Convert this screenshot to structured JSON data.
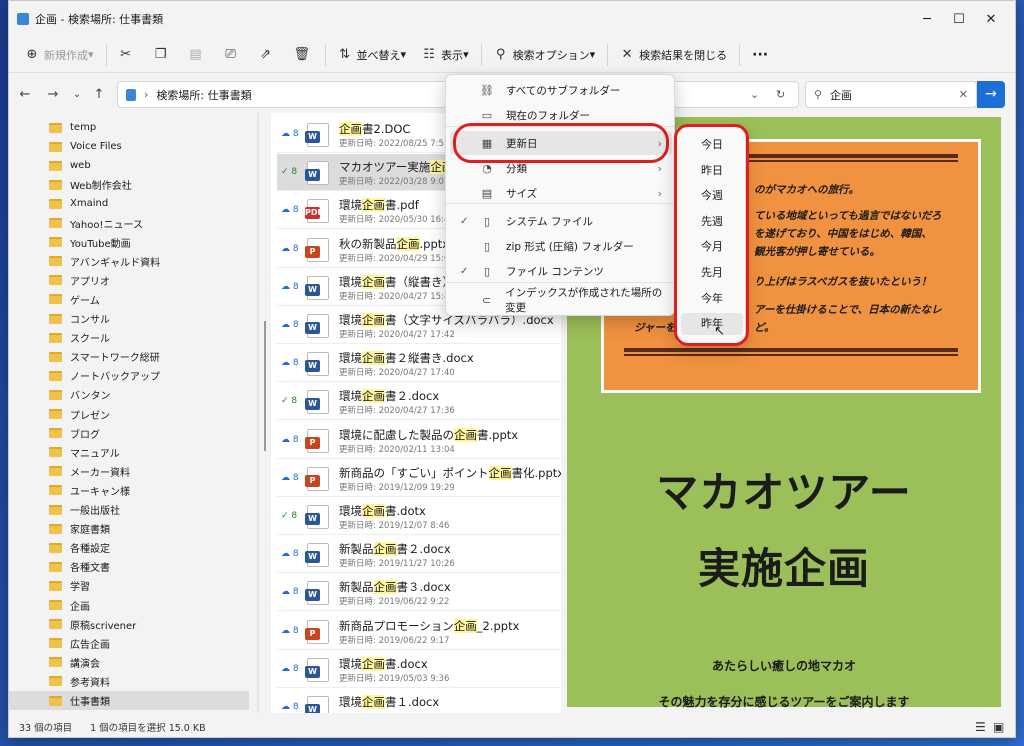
{
  "window": {
    "title": "企画 - 検索場所: 仕事書類"
  },
  "window_controls": {
    "minimize": "─",
    "maximize": "☐",
    "close": "✕"
  },
  "toolbar": {
    "new_label": "新規作成",
    "sort_label": "並べ替え",
    "view_label": "表示",
    "search_options_label": "検索オプション",
    "close_results_label": "検索結果を閉じる",
    "more_label": "···"
  },
  "address": {
    "path": "検索場所: 仕事書類",
    "chevron": "›"
  },
  "search": {
    "value": "企画",
    "clear": "✕",
    "go": "→"
  },
  "sidebar": {
    "items": [
      "temp",
      "Voice Files",
      "web",
      "Web制作会社",
      "Xmaind",
      "Yahoo!ニュース",
      "YouTube動画",
      "アバンギャルド資料",
      "アプリオ",
      "ゲーム",
      "コンサル",
      "スクール",
      "スマートワーク総研",
      "ノートバックアップ",
      "バンタン",
      "プレゼン",
      "ブログ",
      "マニュアル",
      "メーカー資料",
      "ユーキャン様",
      "一般出版社",
      "家庭書類",
      "各種設定",
      "各種文書",
      "学習",
      "企画",
      "原稿scrivener",
      "広告企画",
      "講演会",
      "参考資料",
      "仕事書類"
    ]
  },
  "files": [
    {
      "pre": "",
      "hl": "企画",
      "post": "書2.DOC",
      "date": "更新日時: 2022/08/25 7:53",
      "type": "W",
      "status": "☁ 8"
    },
    {
      "pre": "マカオツアー実施",
      "hl": "企画",
      "post": "3",
      "date": "更新日時: 2022/03/28 9:07",
      "type": "W",
      "status": "✓ 8"
    },
    {
      "pre": "環境",
      "hl": "企画",
      "post": "書.pdf",
      "date": "更新日時: 2020/05/30 16:4",
      "type": "PDF",
      "status": "☁ 8"
    },
    {
      "pre": "秋の新製品",
      "hl": "企画",
      "post": ".pptx",
      "date": "更新日時: 2020/04/29 15:0",
      "type": "P",
      "status": "☁ 8"
    },
    {
      "pre": "環境",
      "hl": "企画",
      "post": "書（縦書き）",
      "date": "更新日時: 2020/04/27 15:4",
      "type": "W",
      "status": "☁ 8"
    },
    {
      "pre": "環境",
      "hl": "企画",
      "post": "書（文字サイズバラバラ）.docx",
      "date": "更新日時: 2020/04/27 17:42",
      "type": "W",
      "status": "☁ 8"
    },
    {
      "pre": "環境",
      "hl": "企画",
      "post": "書２縦書き.docx",
      "date": "更新日時: 2020/04/27 17:40",
      "type": "W",
      "status": "☁ 8"
    },
    {
      "pre": "環境",
      "hl": "企画",
      "post": "書２.docx",
      "date": "更新日時: 2020/04/27 17:36",
      "type": "W",
      "status": "✓ 8"
    },
    {
      "pre": "環境に配慮した製品の",
      "hl": "企画",
      "post": "書.pptx",
      "date": "更新日時: 2020/02/11 13:04",
      "type": "P",
      "status": "☁ 8"
    },
    {
      "pre": "新商品の「すごい」ポイント",
      "hl": "企画",
      "post": "書化.pptx",
      "date": "更新日時: 2019/12/09 19:29",
      "type": "P",
      "status": "☁ 8"
    },
    {
      "pre": "環境",
      "hl": "企画",
      "post": "書.dotx",
      "date": "更新日時: 2019/12/07 8:46",
      "type": "W",
      "status": "✓ 8"
    },
    {
      "pre": "新製品",
      "hl": "企画",
      "post": "書２.docx",
      "date": "更新日時: 2019/11/27 10:26",
      "type": "W",
      "status": "☁ 8"
    },
    {
      "pre": "新製品",
      "hl": "企画",
      "post": "書３.docx",
      "date": "更新日時: 2019/06/22 9:22",
      "type": "W",
      "status": "☁ 8"
    },
    {
      "pre": "新商品プロモーション",
      "hl": "企画",
      "post": "_2.pptx",
      "date": "更新日時: 2019/06/22 9:17",
      "type": "P",
      "status": "☁ 8"
    },
    {
      "pre": "環境",
      "hl": "企画",
      "post": "書.docx",
      "date": "更新日時: 2019/05/03 9:36",
      "type": "W",
      "status": "☁ 8"
    },
    {
      "pre": "環境",
      "hl": "企画",
      "post": "書１.docx",
      "date": "",
      "type": "W",
      "status": "☁ 8"
    }
  ],
  "menu": {
    "items": [
      {
        "label": "すべてのサブフォルダー",
        "icon": "⛓",
        "check": "",
        "arrow": ""
      },
      {
        "label": "現在のフォルダー",
        "icon": "▭",
        "check": "",
        "arrow": ""
      },
      {
        "label": "更新日",
        "icon": "▦",
        "check": "",
        "arrow": "›"
      },
      {
        "label": "分類",
        "icon": "◔",
        "check": "",
        "arrow": "›"
      },
      {
        "label": "サイズ",
        "icon": "▤",
        "check": "",
        "arrow": "›"
      },
      {
        "label": "システム ファイル",
        "icon": "▯",
        "check": "✓",
        "arrow": ""
      },
      {
        "label": "zip 形式 (圧縮) フォルダー",
        "icon": "▯",
        "check": "",
        "arrow": ""
      },
      {
        "label": "ファイル コンテンツ",
        "icon": "▯",
        "check": "✓",
        "arrow": ""
      },
      {
        "label": "インデックスが作成された場所の変更",
        "icon": "⊂",
        "check": "",
        "arrow": ""
      }
    ]
  },
  "submenu": {
    "items": [
      "今日",
      "昨日",
      "今週",
      "先週",
      "今月",
      "先月",
      "今年",
      "昨年"
    ]
  },
  "preview": {
    "lines": [
      "のがマカオへの旅行。",
      "ている地域といっても過言ではないだろ",
      "を遂げており、中国をはじめ、韓国、",
      "観光客が押し寄せている。",
      "り上げはラスベガスを抜いたという！",
      "アーを仕掛けることで、日本の新たなレ",
      "ジャーを",
      "ど。"
    ],
    "title1": "マカオツアー",
    "title2": "実施企画",
    "sub1": "あたらしい癒しの地マカオ",
    "sub2": "その魅力を存分に感じるツアーをご案内します"
  },
  "status": {
    "count": "33 個の項目",
    "selected": "1 個の項目を選択 15.0 KB"
  },
  "colors": {
    "accent": "#1e6ed8",
    "highlight_ring": "#e01e1e",
    "preview_bg": "#9bbf59",
    "preview_box": "#f0923f"
  }
}
